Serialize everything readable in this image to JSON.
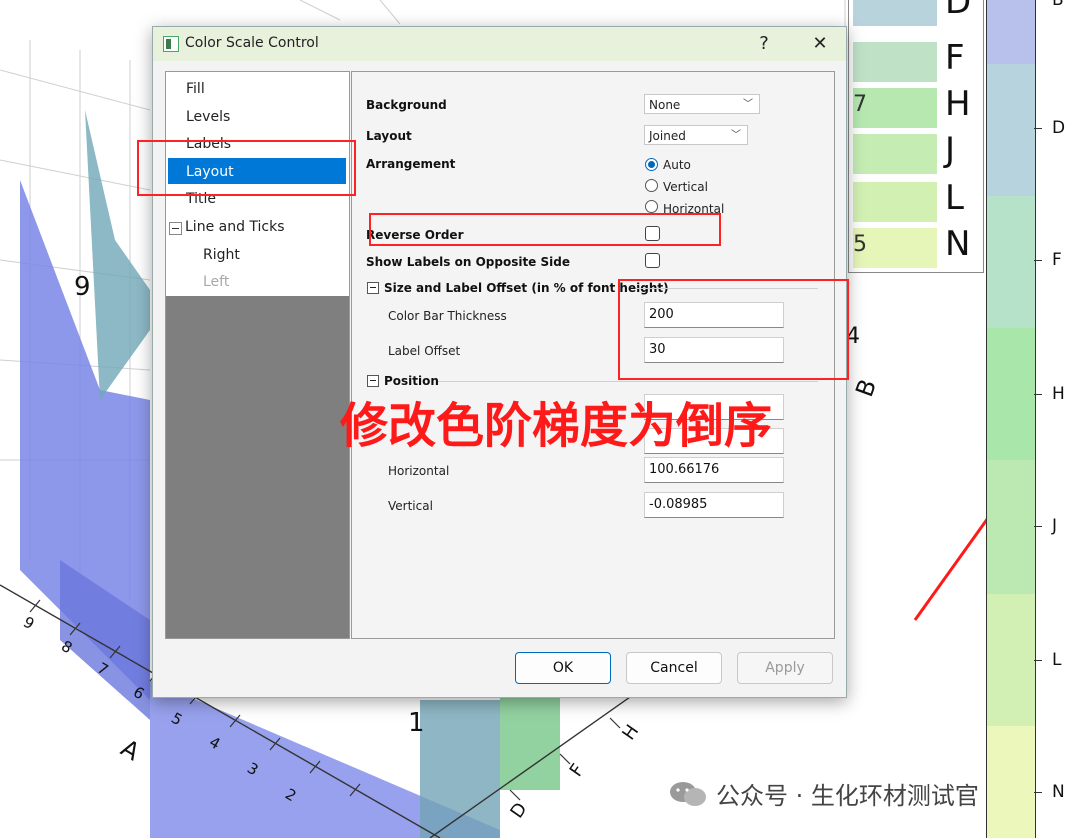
{
  "dialog": {
    "title": "Color Scale Control",
    "help": "?",
    "close": "✕"
  },
  "tree": {
    "items": [
      {
        "label": "Fill"
      },
      {
        "label": "Levels"
      },
      {
        "label": "Labels"
      },
      {
        "label": "Layout",
        "selected": true
      },
      {
        "label": "Title"
      },
      {
        "label": "Line and Ticks"
      },
      {
        "label": "Right"
      },
      {
        "label": "Left",
        "disabled": true
      }
    ]
  },
  "panel": {
    "background": {
      "label": "Background",
      "value": "None"
    },
    "layout": {
      "label": "Layout",
      "value": "Joined"
    },
    "arrangement": {
      "label": "Arrangement",
      "options": [
        "Auto",
        "Vertical",
        "Horizontal"
      ],
      "selected": "Auto"
    },
    "reverse_order": {
      "label": "Reverse Order",
      "checked": false
    },
    "labels_opposite": {
      "label": "Show Labels on Opposite Side",
      "checked": false
    },
    "size_group": {
      "title": "Size and Label Offset (in % of font height)",
      "thickness": {
        "label": "Color Bar Thickness",
        "value": "200"
      },
      "offset": {
        "label": "Label Offset",
        "value": "30"
      }
    },
    "position_group": {
      "title": "Position",
      "horizontal": {
        "label": "Horizontal",
        "value": "100.66176"
      },
      "vertical": {
        "label": "Vertical",
        "value": "-0.08985"
      }
    }
  },
  "buttons": {
    "ok": "OK",
    "cancel": "Cancel",
    "apply": "Apply"
  },
  "annotation": {
    "text": "修改色阶梯度为倒序",
    "color": "#ff1a1a"
  },
  "watermark": "公众号 · 生化环材测试官",
  "legend": {
    "letters": [
      "D",
      "F",
      "H",
      "J",
      "L",
      "N"
    ],
    "subs": [
      "",
      "",
      "7",
      "",
      "",
      "5"
    ],
    "colors": [
      "#b9d3dc",
      "#bfe2c7",
      "#b6e8b0",
      "#c4ecb3",
      "#d3f0b3",
      "#e6f5b8"
    ]
  },
  "colorbar": {
    "labels": [
      "B",
      "D",
      "F",
      "H",
      "J",
      "L",
      "N"
    ],
    "colors": [
      "#b8c0ec",
      "#b7d4de",
      "#b5e2c9",
      "#a9e6a9",
      "#bce9b1",
      "#d2efb4",
      "#ecf7bc"
    ]
  },
  "plot": {
    "axis_letters": [
      "A",
      "B",
      "D",
      "F",
      "H"
    ],
    "numbers": [
      "9",
      "1",
      "6",
      "4",
      "9",
      "8",
      "7",
      "6",
      "5",
      "4",
      "3",
      "2"
    ]
  }
}
